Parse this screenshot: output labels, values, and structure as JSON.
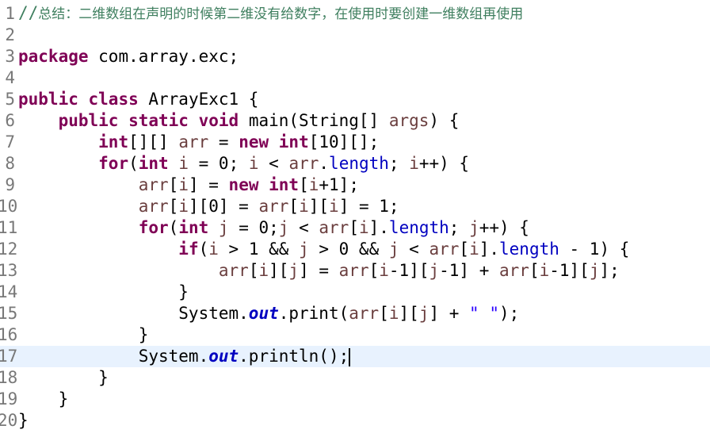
{
  "editor": {
    "lines": [
      {
        "n": "1",
        "c": "//总结：二维数组在声明的时候第二维没有给数字，在使用时要创建一维数组再使用"
      },
      {
        "n": "2",
        "c": ""
      },
      {
        "n": "3",
        "c": "package com.array.exc;"
      },
      {
        "n": "4",
        "c": ""
      },
      {
        "n": "5",
        "c": "public class ArrayExc1 {"
      },
      {
        "n": "6",
        "c": "    public static void main(String[] args) {"
      },
      {
        "n": "7",
        "c": "        int[][] arr = new int[10][];"
      },
      {
        "n": "8",
        "c": "        for(int i = 0; i < arr.length; i++) {"
      },
      {
        "n": "9",
        "c": "            arr[i] = new int[i+1];"
      },
      {
        "n": "10",
        "c": "            arr[i][0] = arr[i][i] = 1;"
      },
      {
        "n": "11",
        "c": "            for(int j = 0;j < arr[i].length; j++) {"
      },
      {
        "n": "12",
        "c": "                if(i > 1 && j > 0 && j < arr[i].length - 1) {"
      },
      {
        "n": "13",
        "c": "                    arr[i][j] = arr[i-1][j-1] + arr[i-1][j];"
      },
      {
        "n": "14",
        "c": "                }"
      },
      {
        "n": "15",
        "c": "                System.out.print(arr[i][j] + \" \");"
      },
      {
        "n": "16",
        "c": "            }"
      },
      {
        "n": "17",
        "c": "            System.out.println();"
      },
      {
        "n": "18",
        "c": "        }"
      },
      {
        "n": "19",
        "c": "    }"
      },
      {
        "n": "20",
        "c": "}"
      }
    ],
    "current_line": "17"
  },
  "colors": {
    "keyword": "#7f0055",
    "local_variable": "#6a3e3e",
    "field": "#0000c0",
    "string": "#2a00ff",
    "comment": "#3f7f5f",
    "line_number": "#787878",
    "current_line_highlight": "#e8f2fe"
  }
}
